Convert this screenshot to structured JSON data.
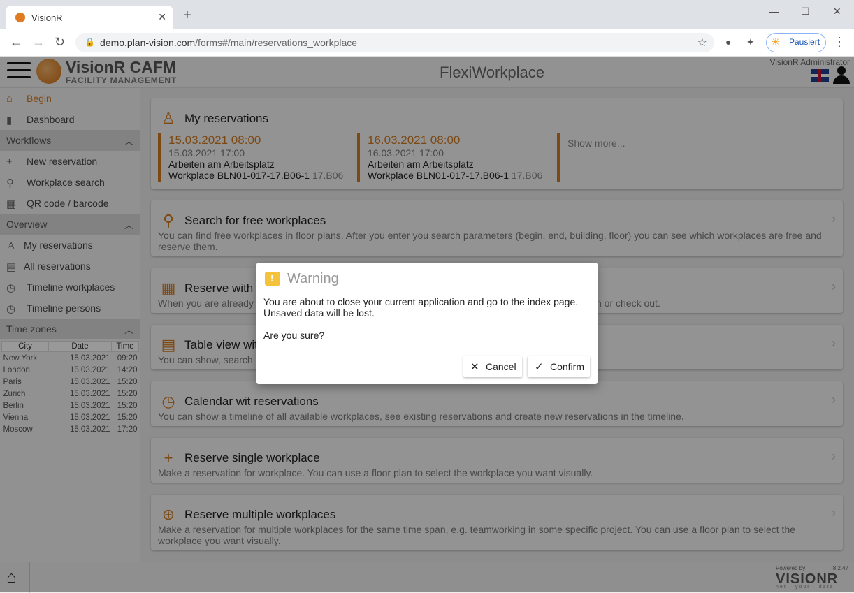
{
  "browser": {
    "tab_title": "VisionR",
    "url_host": "demo.plan-vision.com",
    "url_path": "/forms#/main/reservations_workplace",
    "profile_label": "Pausiert"
  },
  "header": {
    "brand": "VisionR CAFM",
    "brand_sub": "FACILITY MANAGEMENT",
    "title": "FlexiWorkplace",
    "user": "VisionR Administrator"
  },
  "sidebar": {
    "begin": "Begin",
    "dashboard": "Dashboard",
    "workflows": {
      "title": "Workflows",
      "items": [
        "New reservation",
        "Workplace search",
        "QR code / barcode"
      ]
    },
    "overview": {
      "title": "Overview",
      "items": [
        "My reservations",
        "All reservations",
        "Timeline workplaces",
        "Timeline persons"
      ]
    },
    "timezones": {
      "title": "Time zones",
      "headers": [
        "City",
        "Date",
        "Time"
      ],
      "rows": [
        [
          "New York",
          "15.03.2021",
          "09:20"
        ],
        [
          "London",
          "15.03.2021",
          "14:20"
        ],
        [
          "Paris",
          "15.03.2021",
          "15:20"
        ],
        [
          "Zurich",
          "15.03.2021",
          "15:20"
        ],
        [
          "Berlin",
          "15.03.2021",
          "15:20"
        ],
        [
          "Vienna",
          "15.03.2021",
          "15:20"
        ],
        [
          "Moscow",
          "15.03.2021",
          "17:20"
        ]
      ]
    }
  },
  "main": {
    "my_reservations": {
      "title": "My reservations",
      "items": [
        {
          "begin": "15.03.2021 08:00",
          "end": "15.03.2021 17:00",
          "activity": "Arbeiten am Arbeitsplatz",
          "workplace": "Workplace BLN01-017-17.B06-1",
          "room": "17.B06"
        },
        {
          "begin": "16.03.2021 08:00",
          "end": "16.03.2021 17:00",
          "activity": "Arbeiten am Arbeitsplatz",
          "workplace": "Workplace BLN01-017-17.B06-1",
          "room": "17.B06"
        }
      ],
      "show_more": "Show more..."
    },
    "cards": [
      {
        "title": "Search for free workplaces",
        "desc": "You can find free workplaces in floor plans. After you enter you search parameters (begin, end, building, floor) you can see which workplaces are free and reserve them.",
        "icon": "search-icon"
      },
      {
        "title": "Reserve with",
        "desc": "When you are already",
        "desc_right": "k in or check out.",
        "icon": "qr-icon"
      },
      {
        "title": "Table view wit",
        "desc": "You can show, search a",
        "icon": "calendar-icon"
      },
      {
        "title": "Calendar wit reservations",
        "desc": "You can show a timeline of all available workplaces, see existing reservations and create new reservations in the timeline.",
        "icon": "clock-icon"
      },
      {
        "title": "Reserve single workplace",
        "desc": "Make a reservation for workplace. You can use a floor plan to select the workplace you want visually.",
        "icon": "plus-icon"
      },
      {
        "title": "Reserve multiple workplaces",
        "desc": "Make a reservation for multiple workplaces for the same time span, e.g. teamworking in some specific project. You can use a floor plan to select the workplace you want visually.",
        "icon": "plus-circle-icon"
      }
    ]
  },
  "footer": {
    "powered_by": "Powered by",
    "version": "8.2.47",
    "brand": "VISIONR",
    "tagline": "net · your · data"
  },
  "dialog": {
    "title": "Warning",
    "message": "You are about to close your current application and go to the index page. Unsaved data will be lost.",
    "question": "Are you sure?",
    "cancel": "Cancel",
    "confirm": "Confirm"
  }
}
